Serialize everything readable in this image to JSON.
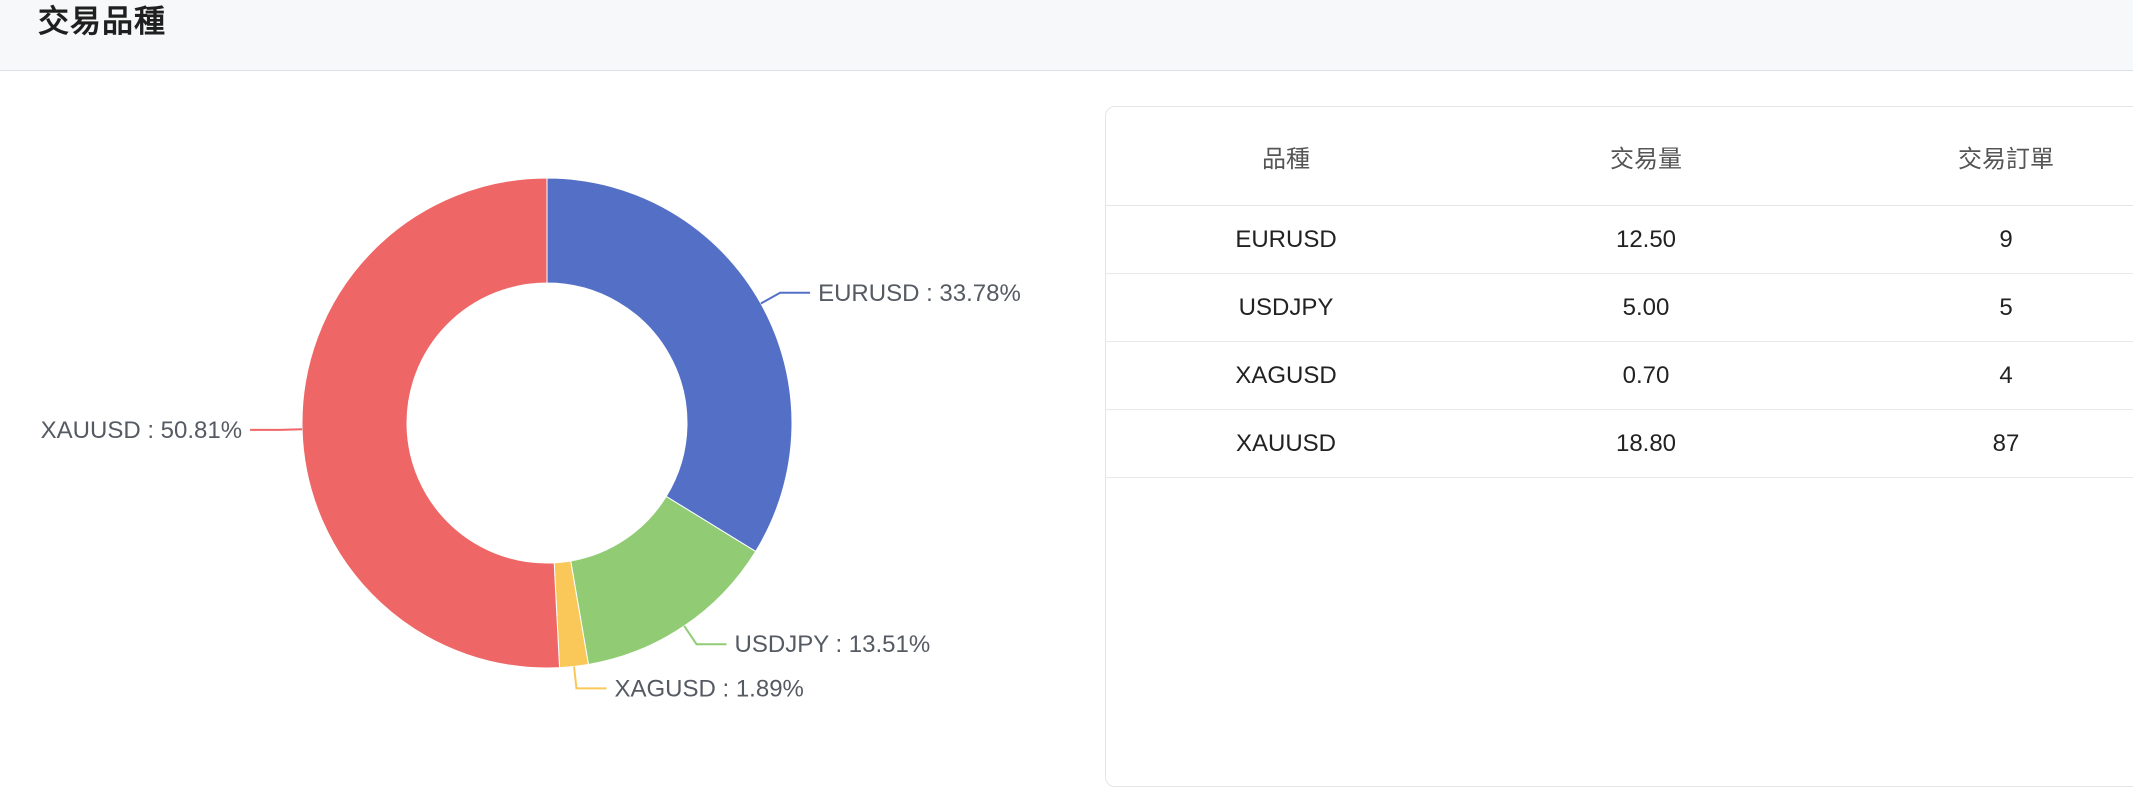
{
  "header": {
    "title": "交易品種"
  },
  "chart_data": {
    "type": "pie",
    "variant": "donut",
    "slices": [
      {
        "name": "EURUSD",
        "value": 33.78,
        "label": "EURUSD : 33.78%",
        "color": "#5470c6"
      },
      {
        "name": "USDJPY",
        "value": 13.51,
        "label": "USDJPY : 13.51%",
        "color": "#91cc75"
      },
      {
        "name": "XAGUSD",
        "value": 1.89,
        "label": "XAGUSD : 1.89%",
        "color": "#fac858"
      },
      {
        "name": "XAUUSD",
        "value": 50.81,
        "label": "XAUUSD : 50.81%",
        "color": "#ee6666"
      }
    ]
  },
  "table": {
    "columns": [
      "品種",
      "交易量",
      "交易訂單"
    ],
    "rows": [
      [
        "EURUSD",
        "12.50",
        "9"
      ],
      [
        "USDJPY",
        "5.00",
        "5"
      ],
      [
        "XAGUSD",
        "0.70",
        "4"
      ],
      [
        "XAUUSD",
        "18.80",
        "87"
      ]
    ]
  }
}
